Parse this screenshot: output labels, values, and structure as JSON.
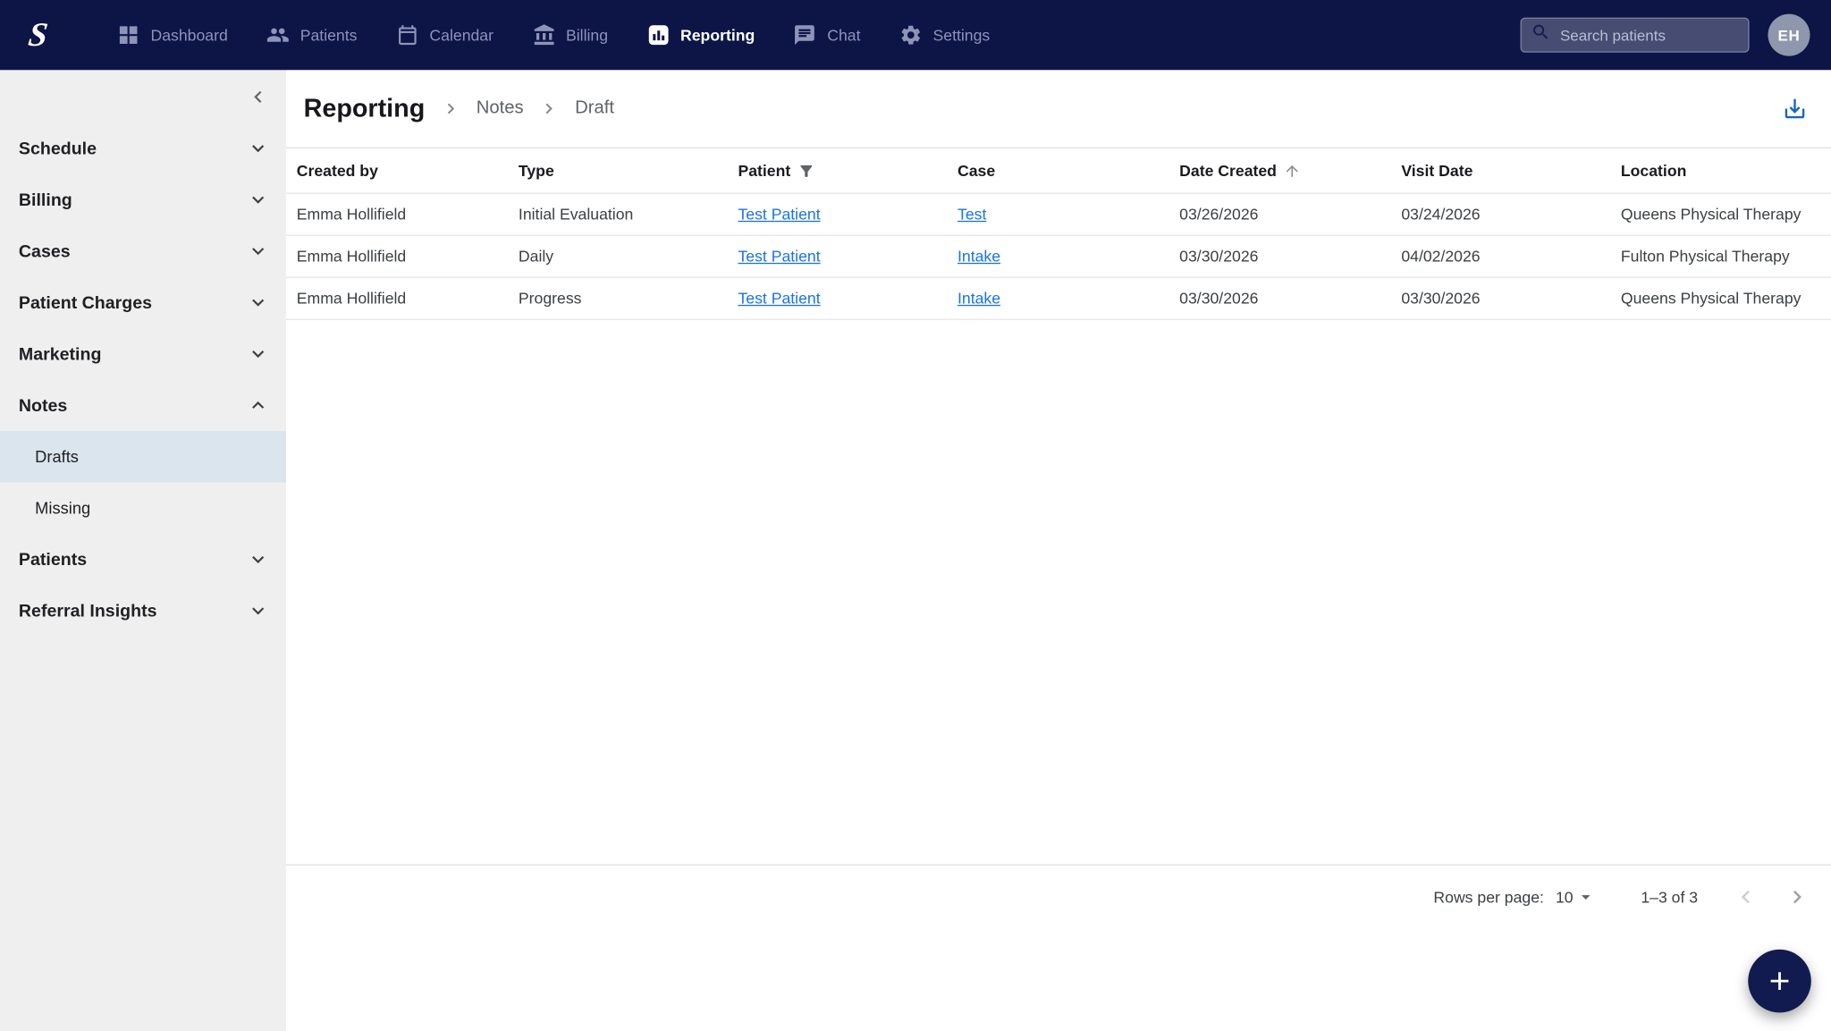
{
  "colors": {
    "topbar": "#0d1446",
    "sidebar_bg": "#efefef",
    "sidebar_selected": "#dbe5ee",
    "link": "#1a73e8",
    "download_icon": "#1565c0",
    "fab": "#111b4f"
  },
  "topnav": {
    "items": [
      {
        "label": "Dashboard",
        "icon": "dashboard-icon",
        "active": false
      },
      {
        "label": "Patients",
        "icon": "patients-icon",
        "active": false
      },
      {
        "label": "Calendar",
        "icon": "calendar-icon",
        "active": false
      },
      {
        "label": "Billing",
        "icon": "billing-icon",
        "active": false
      },
      {
        "label": "Reporting",
        "icon": "reporting-icon",
        "active": true
      },
      {
        "label": "Chat",
        "icon": "chat-icon",
        "active": false
      },
      {
        "label": "Settings",
        "icon": "settings-icon",
        "active": false
      }
    ],
    "search_placeholder": "Search patients",
    "avatar_initials": "EH"
  },
  "sidebar": {
    "items": [
      {
        "label": "Schedule",
        "state": "collapsed"
      },
      {
        "label": "Billing",
        "state": "collapsed"
      },
      {
        "label": "Cases",
        "state": "collapsed"
      },
      {
        "label": "Patient Charges",
        "state": "collapsed"
      },
      {
        "label": "Marketing",
        "state": "collapsed"
      },
      {
        "label": "Notes",
        "state": "expanded",
        "children": [
          {
            "label": "Drafts",
            "selected": true
          },
          {
            "label": "Missing",
            "selected": false
          }
        ]
      },
      {
        "label": "Patients",
        "state": "collapsed"
      },
      {
        "label": "Referral Insights",
        "state": "collapsed"
      }
    ]
  },
  "breadcrumb": {
    "root": "Reporting",
    "crumbs": [
      "Notes",
      "Draft"
    ]
  },
  "table": {
    "columns": [
      "Created by",
      "Type",
      "Patient",
      "Case",
      "Date Created",
      "Visit Date",
      "Location"
    ],
    "rows": [
      {
        "created_by": "Emma Hollifield",
        "type": "Initial Evaluation",
        "patient": "Test Patient",
        "case": "Test",
        "date_created": "03/26/2026",
        "visit_date": "03/24/2026",
        "location": "Queens Physical Therapy"
      },
      {
        "created_by": "Emma Hollifield",
        "type": "Daily",
        "patient": "Test Patient",
        "case": "Intake",
        "date_created": "03/30/2026",
        "visit_date": "04/02/2026",
        "location": "Fulton Physical Therapy"
      },
      {
        "created_by": "Emma Hollifield",
        "type": "Progress",
        "patient": "Test Patient",
        "case": "Intake",
        "date_created": "03/30/2026",
        "visit_date": "03/30/2026",
        "location": "Queens Physical Therapy"
      }
    ]
  },
  "pagination": {
    "rows_per_page_label": "Rows per page:",
    "rows_per_page_value": "10",
    "range_label": "1–3 of 3"
  }
}
